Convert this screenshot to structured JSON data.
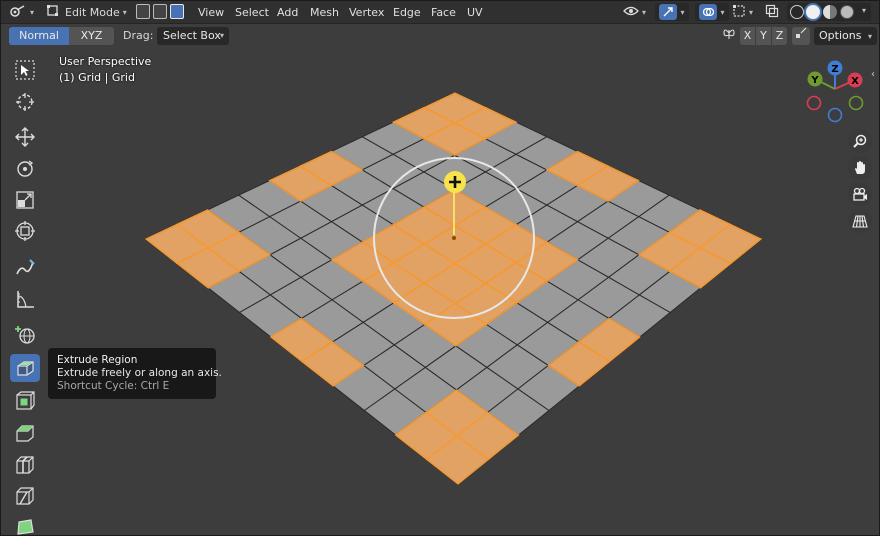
{
  "header": {
    "mode_label": "Edit Mode",
    "menus": [
      "View",
      "Select",
      "Add",
      "Mesh",
      "Vertex",
      "Edge",
      "Face",
      "UV"
    ]
  },
  "tool_settings": {
    "orientation_normal": "Normal",
    "orientation_xyz": "XYZ",
    "drag_label": "Drag:",
    "drag_value": "Select Box",
    "axis_x": "X",
    "axis_y": "Y",
    "axis_z": "Z",
    "options_label": "Options"
  },
  "viewport": {
    "view_name": "User Perspective",
    "object_info": "(1) Grid | Grid"
  },
  "tooltip": {
    "title": "Extrude Region",
    "description": "Extrude freely or along an axis.",
    "shortcut": "Shortcut Cycle: Ctrl E"
  },
  "gizmo": {
    "x": "X",
    "y": "Y",
    "z": "Z"
  },
  "mesh": {
    "grid_size": 10,
    "selected_faces": [
      [
        0,
        0
      ],
      [
        0,
        1
      ],
      [
        1,
        0
      ],
      [
        1,
        1
      ],
      [
        0,
        8
      ],
      [
        0,
        9
      ],
      [
        1,
        8
      ],
      [
        1,
        9
      ],
      [
        8,
        0
      ],
      [
        8,
        1
      ],
      [
        9,
        0
      ],
      [
        9,
        1
      ],
      [
        8,
        8
      ],
      [
        8,
        9
      ],
      [
        9,
        8
      ],
      [
        9,
        9
      ],
      [
        0,
        4
      ],
      [
        0,
        5
      ],
      [
        4,
        0
      ],
      [
        5,
        0
      ],
      [
        9,
        4
      ],
      [
        9,
        5
      ],
      [
        4,
        9
      ],
      [
        5,
        9
      ],
      [
        3,
        3
      ],
      [
        3,
        4
      ],
      [
        3,
        5
      ],
      [
        3,
        6
      ],
      [
        4,
        3
      ],
      [
        4,
        4
      ],
      [
        4,
        5
      ],
      [
        4,
        6
      ],
      [
        5,
        3
      ],
      [
        5,
        4
      ],
      [
        5,
        5
      ],
      [
        5,
        6
      ],
      [
        6,
        3
      ],
      [
        6,
        4
      ],
      [
        6,
        5
      ],
      [
        6,
        6
      ]
    ]
  },
  "colors": {
    "header_bg": "#303030",
    "active_blue": "#4772b3",
    "face_grey": "#9a9a9a",
    "face_selected": "#e2a263",
    "edge_selected": "#ff9a2a",
    "axis_x": "#d63e52",
    "axis_y": "#6d9b2d",
    "axis_z": "#3e7ed6"
  }
}
